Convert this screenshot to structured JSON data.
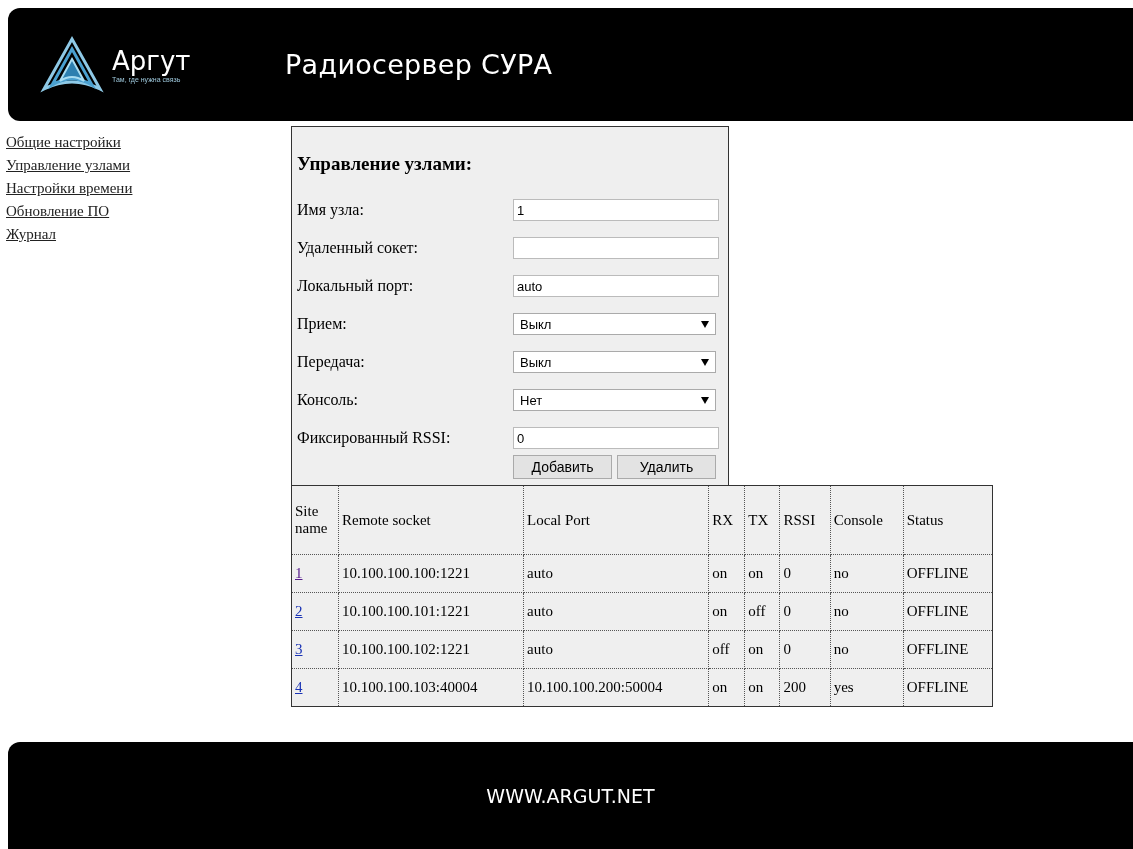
{
  "header": {
    "logo_name": "Аргут",
    "logo_tagline": "Там, где нужна связь",
    "title": "Радиосервер СУРА"
  },
  "sidebar": {
    "items": [
      {
        "label": "Общие настройки"
      },
      {
        "label": "Управление узлами"
      },
      {
        "label": "Настройки времени"
      },
      {
        "label": "Обновление ПО"
      },
      {
        "label": "Журнал"
      }
    ]
  },
  "form": {
    "title": "Управление узлами:",
    "fields": [
      {
        "label": "Имя узла:",
        "kind": "text",
        "value": "1"
      },
      {
        "label": "Удаленный сокет:",
        "kind": "text"
      },
      {
        "label": "Локальный порт:",
        "kind": "text",
        "value": "auto"
      },
      {
        "label": "Прием:",
        "kind": "select",
        "value": "Выкл"
      },
      {
        "label": "Передача:",
        "kind": "select",
        "value": "Выкл"
      },
      {
        "label": "Консоль:",
        "kind": "select",
        "value": "Нет"
      },
      {
        "label": "Фиксированный RSSI:",
        "kind": "text",
        "value": "0"
      }
    ],
    "buttons": [
      "Добавить",
      "Удалить"
    ]
  },
  "table": {
    "columns": [
      "Site name",
      "Remote socket",
      "Local Port",
      "RX",
      "TX",
      "RSSI",
      "Console",
      "Status"
    ],
    "rows": [
      {
        "visited": true,
        "cells": [
          "1",
          "10.100.100.100:1221",
          "auto",
          "on",
          "on",
          "0",
          "no",
          "OFFLINE"
        ]
      },
      {
        "visited": false,
        "cells": [
          "2",
          "10.100.100.101:1221",
          "auto",
          "on",
          "off",
          "0",
          "no",
          "OFFLINE"
        ]
      },
      {
        "visited": false,
        "cells": [
          "3",
          "10.100.100.102:1221",
          "auto",
          "off",
          "on",
          "0",
          "no",
          "OFFLINE"
        ]
      },
      {
        "visited": false,
        "cells": [
          "4",
          "10.100.100.103:40004",
          "10.100.100.200:50004",
          "on",
          "on",
          "200",
          "yes",
          "OFFLINE"
        ]
      }
    ]
  },
  "footer": {
    "text": "WWW.ARGUT.NET"
  }
}
